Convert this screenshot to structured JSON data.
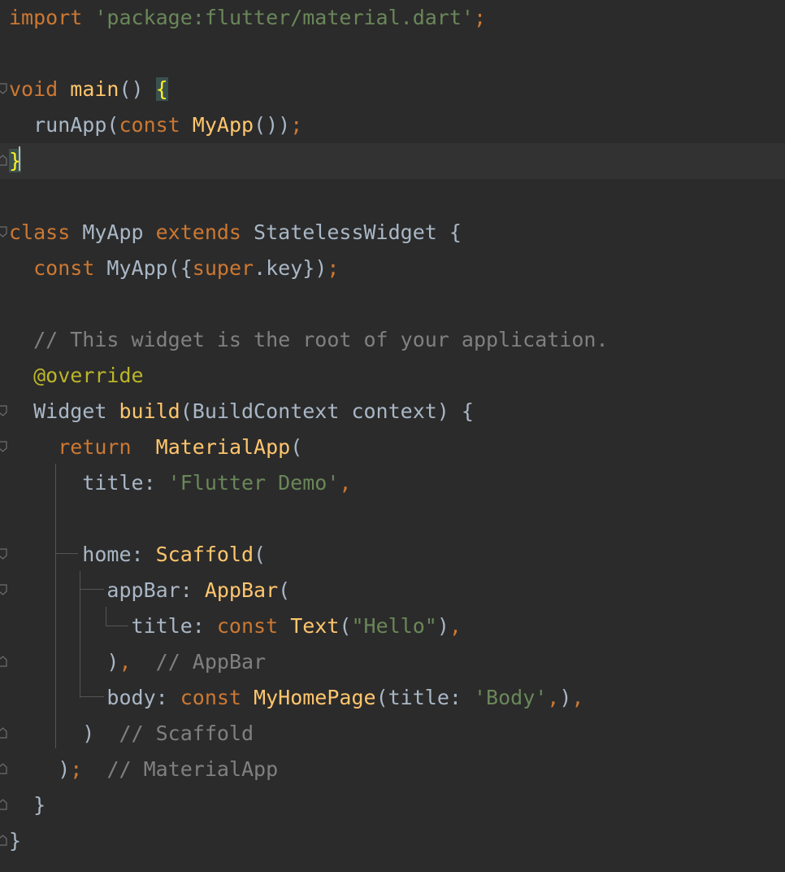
{
  "editor": {
    "lines": [
      {
        "id": "l1",
        "tokens": [
          {
            "t": "import",
            "c": "kw"
          },
          {
            "t": " "
          },
          {
            "t": "'package:flutter/material.dart'",
            "c": "str"
          },
          {
            "t": ";",
            "c": "kw"
          }
        ]
      },
      {
        "id": "l2",
        "tokens": []
      },
      {
        "id": "l3",
        "fold": "open",
        "tokens": [
          {
            "t": "void",
            "c": "kw"
          },
          {
            "t": " "
          },
          {
            "t": "main",
            "c": "fn"
          },
          {
            "t": "() "
          },
          {
            "t": "{",
            "c": "brace-hl"
          }
        ]
      },
      {
        "id": "l4",
        "tokens": [
          {
            "t": "  runApp("
          },
          {
            "t": "const",
            "c": "kw"
          },
          {
            "t": " "
          },
          {
            "t": "MyApp",
            "c": "fn"
          },
          {
            "t": "())"
          },
          {
            "t": ";",
            "c": "kw"
          }
        ]
      },
      {
        "id": "l5",
        "fold": "close",
        "current": true,
        "tokens": [
          {
            "t": "}",
            "c": "brace-hl"
          }
        ]
      },
      {
        "id": "l6",
        "tokens": []
      },
      {
        "id": "l7",
        "fold": "open",
        "tokens": [
          {
            "t": "class",
            "c": "kw"
          },
          {
            "t": " MyApp "
          },
          {
            "t": "extends",
            "c": "kw"
          },
          {
            "t": " StatelessWidget {"
          }
        ]
      },
      {
        "id": "l8",
        "tokens": [
          {
            "t": "  "
          },
          {
            "t": "const",
            "c": "kw"
          },
          {
            "t": " MyApp({"
          },
          {
            "t": "super",
            "c": "sup"
          },
          {
            "t": ".key})"
          },
          {
            "t": ";",
            "c": "kw"
          }
        ]
      },
      {
        "id": "l9",
        "tokens": []
      },
      {
        "id": "l10",
        "tokens": [
          {
            "t": "  // This widget is the root of your application.",
            "c": "cmt"
          }
        ]
      },
      {
        "id": "l11",
        "tokens": [
          {
            "t": "  "
          },
          {
            "t": "@",
            "c": "ann"
          },
          {
            "t": "override",
            "c": "ann"
          }
        ]
      },
      {
        "id": "l12",
        "fold": "open",
        "tokens": [
          {
            "t": "  Widget "
          },
          {
            "t": "build",
            "c": "fn"
          },
          {
            "t": "(BuildContext context) {"
          }
        ]
      },
      {
        "id": "l13",
        "fold": "open",
        "tokens": [
          {
            "t": "    "
          },
          {
            "t": "return",
            "c": "kw"
          },
          {
            "t": "  "
          },
          {
            "t": "MaterialApp",
            "c": "fn"
          },
          {
            "t": "("
          }
        ]
      },
      {
        "id": "l14",
        "tokens": [
          {
            "t": "      title: "
          },
          {
            "t": "'Flutter Demo'",
            "c": "str"
          },
          {
            "t": ",",
            "c": "kw"
          }
        ]
      },
      {
        "id": "l15",
        "tokens": []
      },
      {
        "id": "l16",
        "fold": "open",
        "tokens": [
          {
            "t": "      home: "
          },
          {
            "t": "Scaffold",
            "c": "fn"
          },
          {
            "t": "("
          }
        ]
      },
      {
        "id": "l17",
        "fold": "open",
        "tokens": [
          {
            "t": "        appBar: "
          },
          {
            "t": "AppBar",
            "c": "fn"
          },
          {
            "t": "("
          }
        ]
      },
      {
        "id": "l18",
        "tokens": [
          {
            "t": "          title: "
          },
          {
            "t": "const",
            "c": "kw"
          },
          {
            "t": " "
          },
          {
            "t": "Text",
            "c": "fn"
          },
          {
            "t": "("
          },
          {
            "t": "\"Hello\"",
            "c": "str"
          },
          {
            "t": ")"
          },
          {
            "t": ",",
            "c": "kw"
          }
        ]
      },
      {
        "id": "l19",
        "fold": "close",
        "tokens": [
          {
            "t": "        )"
          },
          {
            "t": ",",
            "c": "kw"
          },
          {
            "t": "  "
          },
          {
            "t": "// AppBar",
            "c": "cmt"
          }
        ]
      },
      {
        "id": "l20",
        "tokens": [
          {
            "t": "        body: "
          },
          {
            "t": "const",
            "c": "kw"
          },
          {
            "t": " "
          },
          {
            "t": "MyHomePage",
            "c": "fn"
          },
          {
            "t": "(title: "
          },
          {
            "t": "'Body'",
            "c": "str"
          },
          {
            "t": ",",
            "c": "kw"
          },
          {
            "t": ")"
          },
          {
            "t": ",",
            "c": "kw"
          }
        ]
      },
      {
        "id": "l21",
        "fold": "close",
        "tokens": [
          {
            "t": "      )  "
          },
          {
            "t": "// Scaffold",
            "c": "cmt"
          }
        ]
      },
      {
        "id": "l22",
        "fold": "close",
        "tokens": [
          {
            "t": "    )"
          },
          {
            "t": ";",
            "c": "kw"
          },
          {
            "t": "  "
          },
          {
            "t": "// MaterialApp",
            "c": "cmt"
          }
        ]
      },
      {
        "id": "l23",
        "fold": "close",
        "tokens": [
          {
            "t": "  }"
          }
        ]
      },
      {
        "id": "l24",
        "fold": "close",
        "tokens": [
          {
            "t": "}"
          }
        ]
      }
    ]
  },
  "colors": {
    "background": "#2b2b2b",
    "current_line": "#323232",
    "keyword": "#cc7832",
    "function": "#ffc66d",
    "string": "#6a8759",
    "comment": "#808080",
    "annotation": "#bbb529",
    "default_text": "#a9b7c6",
    "brace_match_bg": "#3b514d",
    "brace_match_fg": "#ffef28"
  },
  "icons": {
    "fold_open": "fold-open-icon",
    "fold_close": "fold-close-icon"
  }
}
